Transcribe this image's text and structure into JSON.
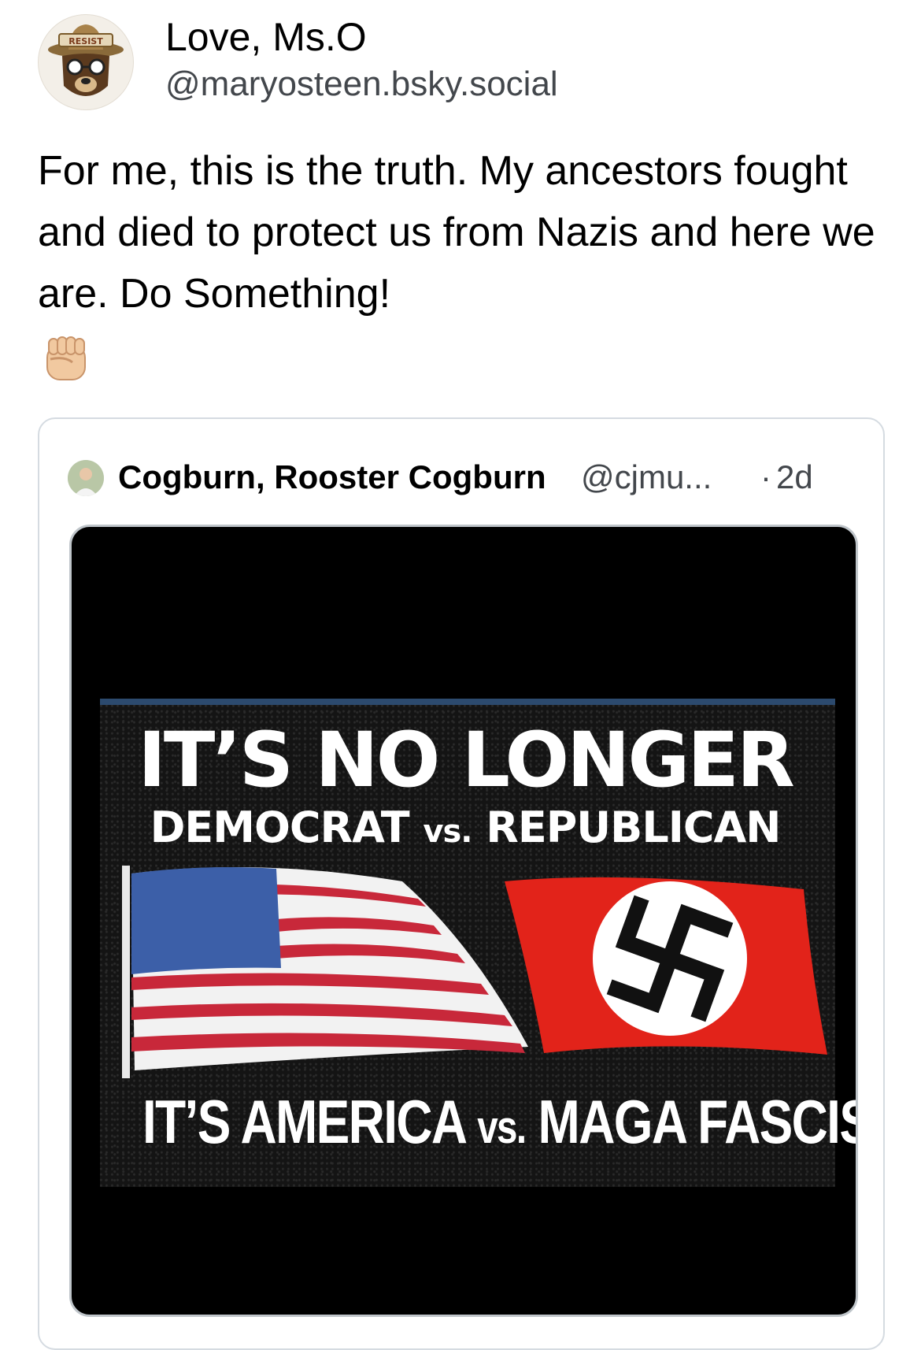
{
  "post": {
    "author": {
      "display_name": "Love, Ms.O",
      "handle": "@maryosteen.bsky.social",
      "avatar_icon": "smokey-bear-resist-icon",
      "avatar_badge": "RESIST"
    },
    "text": "For me, this is the truth. My ancestors fought and died to protect us from Nazis and here we are. Do Something!",
    "emoji": "✊🏼"
  },
  "quote": {
    "author": {
      "display_name": "Cogburn, Rooster Cogburn",
      "handle": "@cjmu...",
      "separator": "·",
      "time": "2d",
      "avatar_icon": "user-photo-icon"
    },
    "image": {
      "line1": "IT’S NO LONGER",
      "line2_left": "DEMOCRAT",
      "line2_vs": "vs.",
      "line2_right": "REPUBLICAN",
      "line3_left": "IT’S AMERICA",
      "line3_vs": "vs.",
      "line3_right": "MAGA FASCISM"
    }
  },
  "colors": {
    "text": "#000000",
    "secondary_text": "#43474c",
    "card_border": "#d5dbe1",
    "us_blue": "#3c5fa8",
    "us_red": "#c8283a",
    "flag_red": "#e2231a"
  }
}
